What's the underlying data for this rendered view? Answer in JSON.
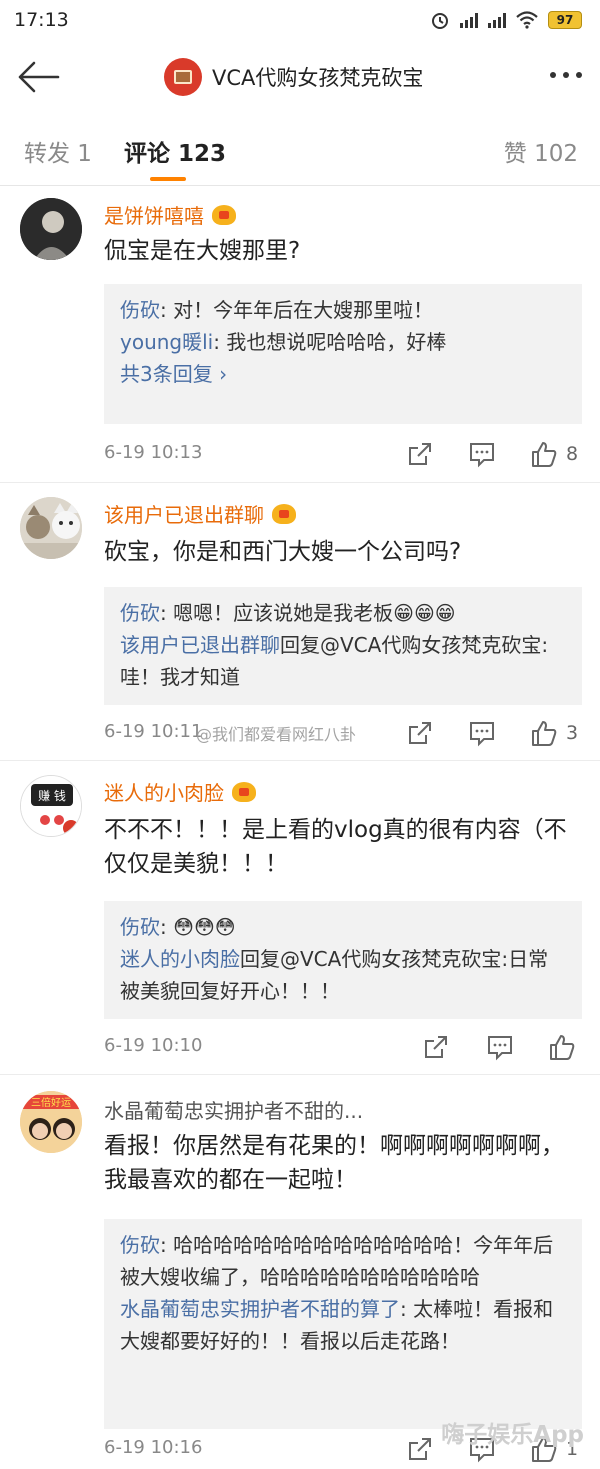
{
  "status_bar": {
    "time": "17:13",
    "battery": "97"
  },
  "nav": {
    "title": "VCA代购女孩梵克砍宝"
  },
  "tabs": {
    "reposts": "转发 1",
    "comments": "评论 123",
    "likes": "赞 102"
  },
  "comments": [
    {
      "username": "是饼饼嘻嘻",
      "vip": true,
      "text": "侃宝是在大嫂那里?",
      "replies": [
        {
          "author": "伤砍",
          "sep": ": ",
          "text": "对！今年年后在大嫂那里啦！"
        },
        {
          "author": "young暖li",
          "sep": ": ",
          "text": "我也想说呢哈哈哈，好棒"
        }
      ],
      "more_replies": "共3条回复 ›",
      "time": "6-19 10:13",
      "like_count": "8"
    },
    {
      "username": "该用户已退出群聊",
      "vip": true,
      "text": "砍宝，你是和西门大嫂一个公司吗?",
      "replies": [
        {
          "author": "伤砍",
          "sep": ": ",
          "text": "嗯嗯！应该说她是我老板😁😁😁"
        },
        {
          "author": "该用户已退出群聊",
          "sep": "",
          "text": "回复@VCA代购女孩梵克砍宝:哇！我才知道"
        }
      ],
      "time": "6-19 10:11",
      "like_count": "3"
    },
    {
      "username": "迷人的小肉脸",
      "vip": true,
      "text": "不不不！！！是上看的vlog真的很有内容（不仅仅是美貌！！！",
      "replies": [
        {
          "author": "伤砍",
          "sep": ": ",
          "text": "😳😳😳"
        },
        {
          "author": "迷人的小肉脸",
          "sep": "",
          "text": "回复@VCA代购女孩梵克砍宝:日常被美貌回复好开心！！！"
        }
      ],
      "time": "6-19 10:10",
      "like_count": ""
    },
    {
      "username": "水晶葡萄忠实拥护者不甜的...",
      "vip": false,
      "text": "看报！你居然是有花果的！啊啊啊啊啊啊啊，我最喜欢的都在一起啦！",
      "replies": [
        {
          "author": "伤砍",
          "sep": ": ",
          "text": "哈哈哈哈哈哈哈哈哈哈哈哈哈哈！今年年后被大嫂收编了，哈哈哈哈哈哈哈哈哈哈哈"
        },
        {
          "author": "水晶葡萄忠实拥护者不甜的算了",
          "sep": ": ",
          "text": "太棒啦！看报和大嫂都要好好的！！看报以后走花路！"
        }
      ],
      "time": "6-19 10:16",
      "like_count": "1"
    }
  ],
  "avatar_text": {
    "c3_badge": "赚 钱",
    "c4_banner": "三倍好运"
  },
  "watermark": "@我们都爱看网红八卦",
  "app_mark": "嗨子娱乐App",
  "colors": {
    "accent": "#ff8200",
    "username": "#e86b0a",
    "link": "#4a6fa5",
    "reply_bg": "#f2f2f2"
  }
}
